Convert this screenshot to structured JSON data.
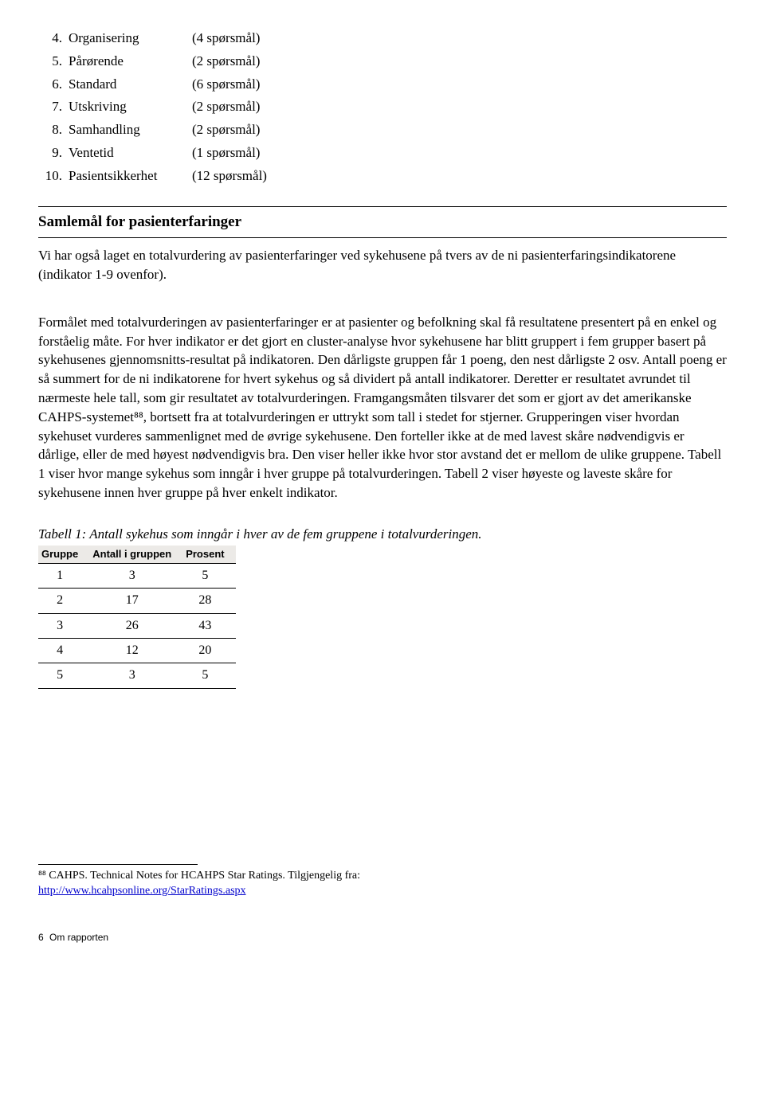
{
  "list": [
    {
      "num": "4.",
      "label": "Organisering",
      "count": "(4 spørsmål)"
    },
    {
      "num": "5.",
      "label": "Pårørende",
      "count": "(2 spørsmål)"
    },
    {
      "num": "6.",
      "label": "Standard",
      "count": "(6 spørsmål)"
    },
    {
      "num": "7.",
      "label": "Utskriving",
      "count": "(2 spørsmål)"
    },
    {
      "num": "8.",
      "label": "Samhandling",
      "count": "(2 spørsmål)"
    },
    {
      "num": "9.",
      "label": "Ventetid",
      "count": "(1 spørsmål)"
    },
    {
      "num": "10.",
      "label": "Pasientsikkerhet",
      "count": "(12 spørsmål)"
    }
  ],
  "heading": "Samlemål for pasienterfaringer",
  "intro": "Vi har også laget en totalvurdering av pasienterfaringer ved sykehusene på tvers av de ni pasienterfaringsindikatorene (indikator 1-9 ovenfor).",
  "body": "Formålet med totalvurderingen av pasienterfaringer er at pasienter og befolkning skal få resultatene presentert på en enkel og forståelig måte. For hver indikator er det gjort en cluster-analyse hvor sykehusene har blitt gruppert i fem grupper basert på sykehusenes gjennomsnitts-resultat på indikatoren. Den dårligste gruppen får 1 poeng, den nest dårligste 2 osv. Antall poeng er så summert for de ni indikatorene for hvert sykehus og så dividert på antall indikatorer. Deretter er resultatet avrundet til nærmeste hele tall, som gir resultatet av totalvurderingen. Framgangsmåten tilsvarer det som er gjort av det amerikanske CAHPS-systemet⁸⁸, bortsett fra at totalvurderingen er uttrykt som tall i stedet for stjerner. Grupperingen viser hvordan sykehuset vurderes sammenlignet med de øvrige sykehusene. Den forteller ikke at de med lavest skåre nødvendigvis er dårlige, eller de med høyest nødvendigvis bra. Den viser heller ikke hvor stor avstand det er mellom de ulike gruppene. Tabell 1 viser hvor mange sykehus som inngår i hver gruppe på totalvurderingen. Tabell 2 viser høyeste og laveste skåre for sykehusene innen hver gruppe på hver enkelt indikator.",
  "table": {
    "caption": "Tabell 1: Antall sykehus som inngår i hver av de fem gruppene i totalvurderingen.",
    "headers": [
      "Gruppe",
      "Antall i gruppen",
      "Prosent"
    ],
    "rows": [
      [
        "1",
        "3",
        "5"
      ],
      [
        "2",
        "17",
        "28"
      ],
      [
        "3",
        "26",
        "43"
      ],
      [
        "4",
        "12",
        "20"
      ],
      [
        "5",
        "3",
        "5"
      ]
    ]
  },
  "footnote": {
    "text": "⁸⁸ CAHPS. Technical Notes for HCAHPS Star Ratings. Tilgjengelig fra:",
    "link": "http://www.hcahpsonline.org/StarRatings.aspx"
  },
  "footer": {
    "page": "6",
    "section": "Om rapporten"
  }
}
